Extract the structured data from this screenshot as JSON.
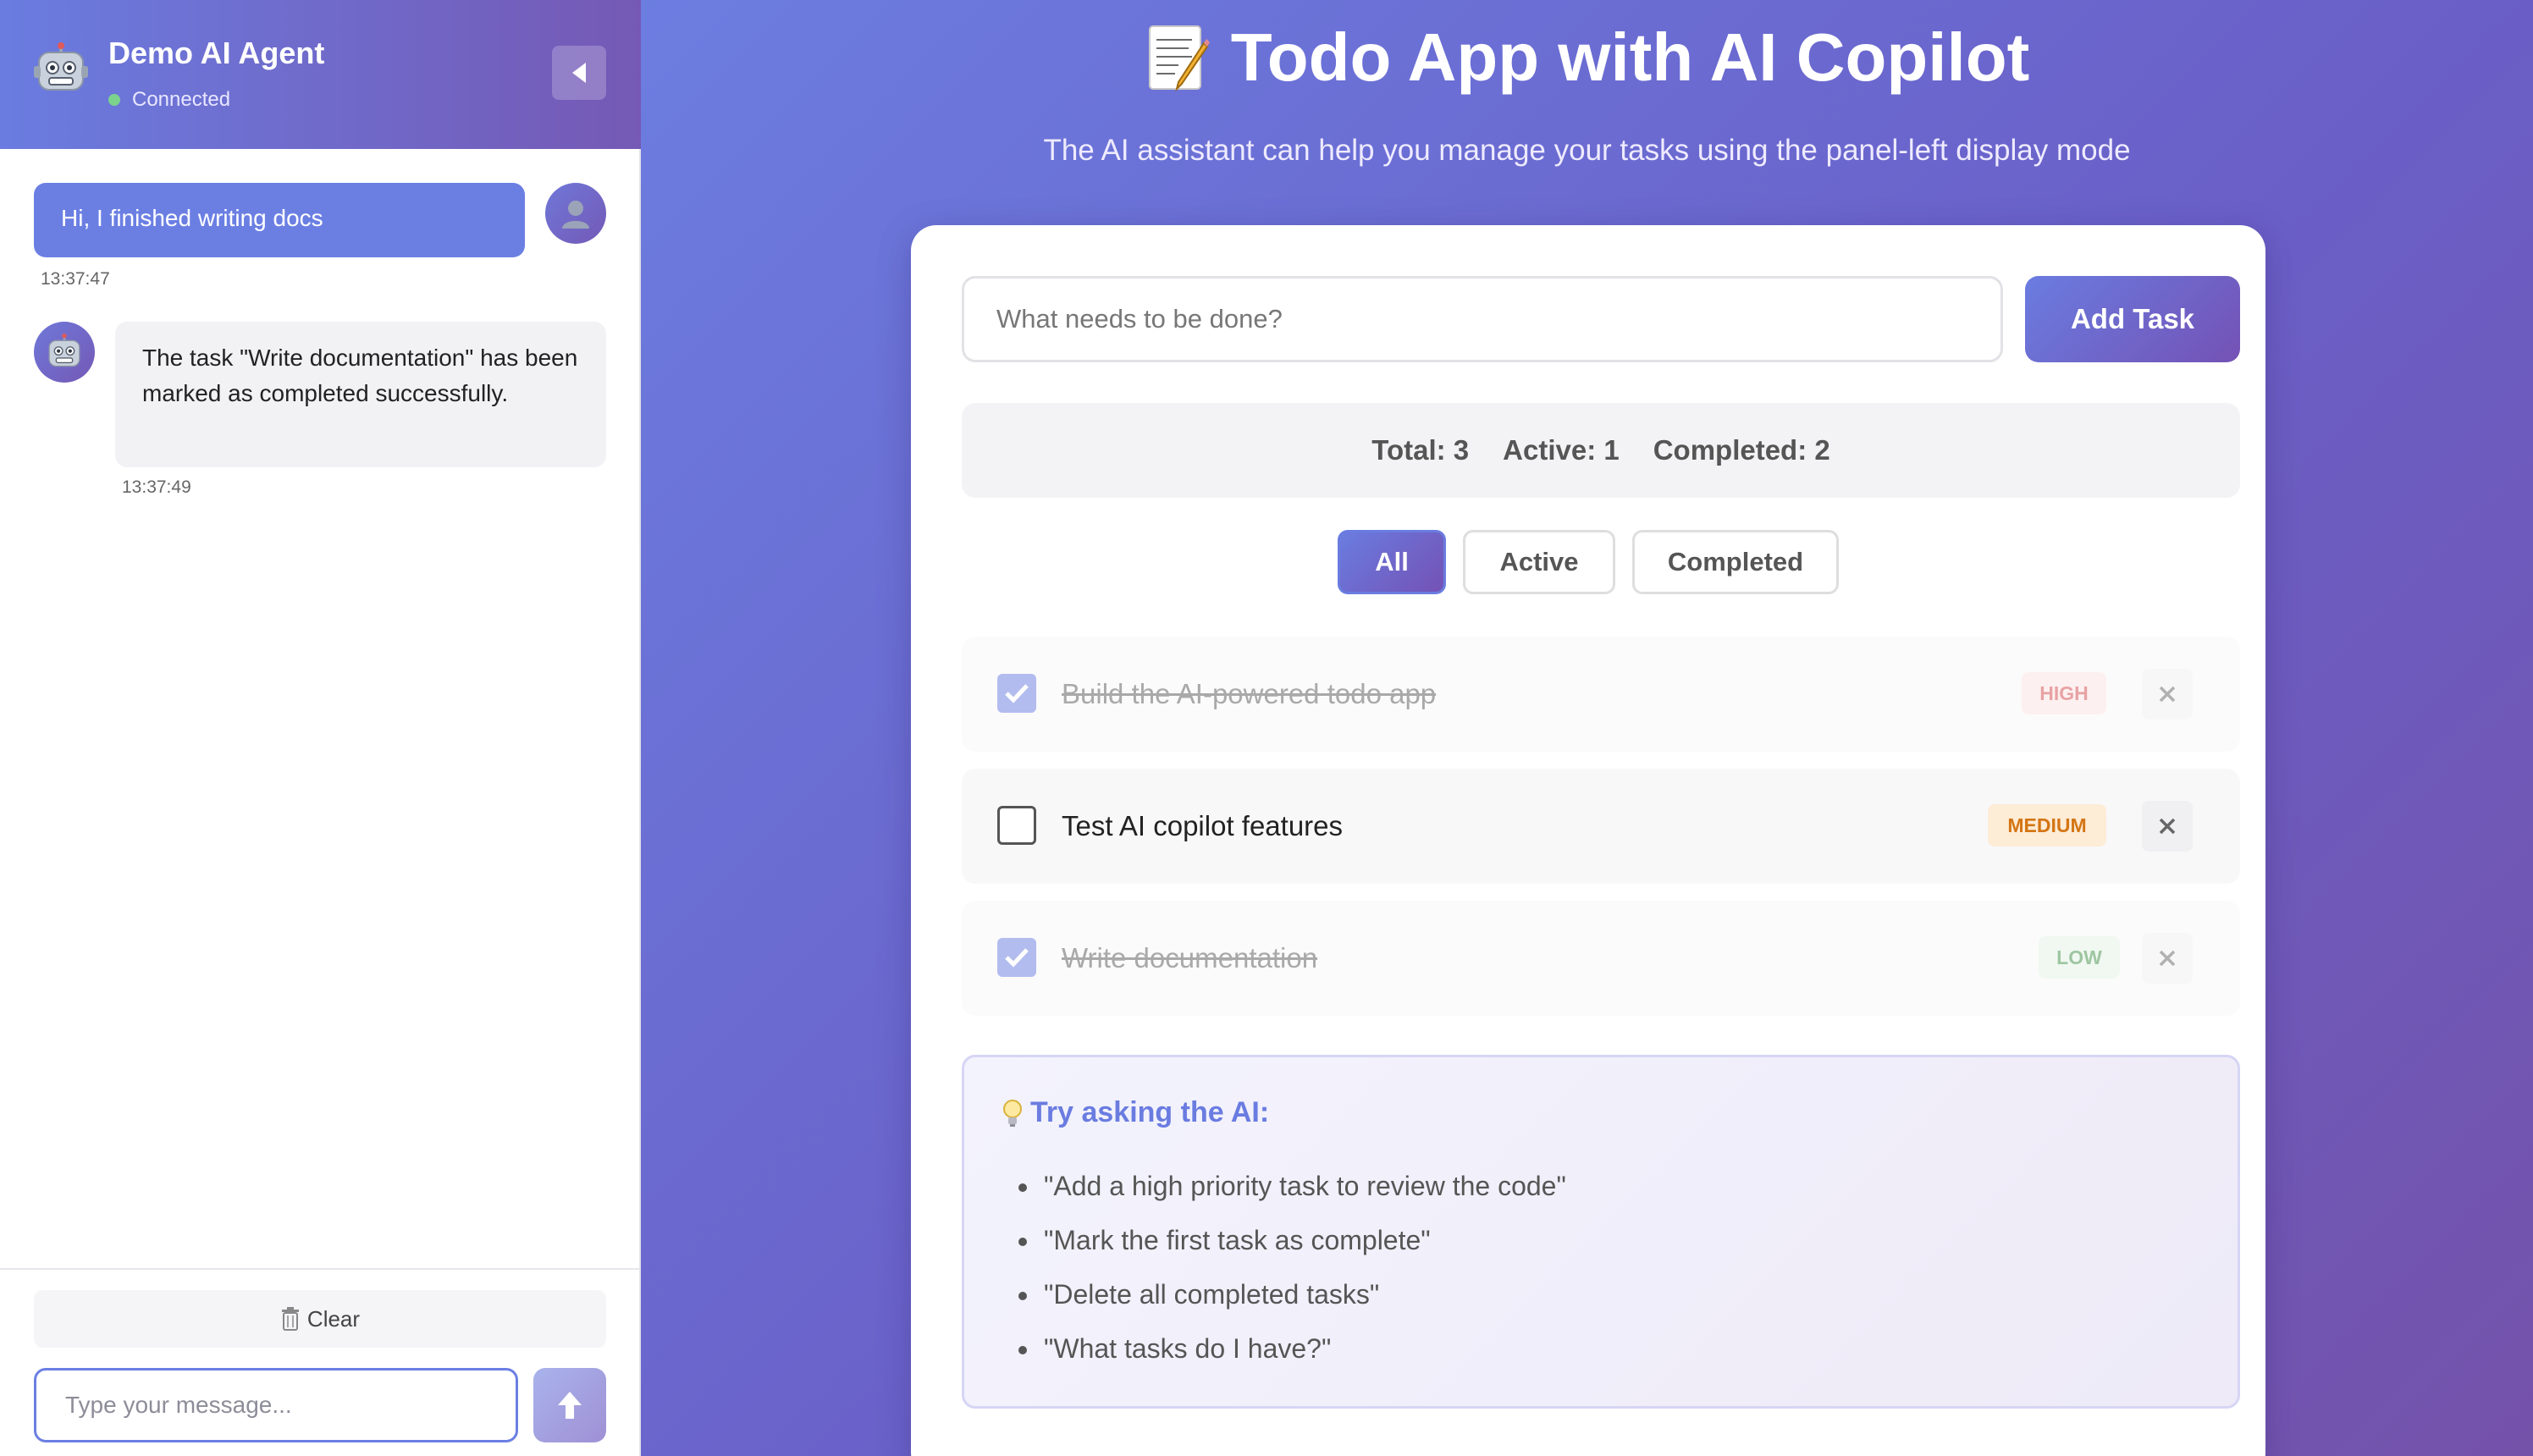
{
  "sidebar": {
    "agent_name": "Demo AI Agent",
    "status": "Connected",
    "messages": [
      {
        "role": "user",
        "text": "Hi, I finished writing docs",
        "time": "13:37:47"
      },
      {
        "role": "assistant",
        "text": "The task \"Write documentation\" has been marked as completed successfully.",
        "time": "13:37:49"
      }
    ],
    "clear_label": "Clear",
    "input_placeholder": "Type your message..."
  },
  "main": {
    "title": "Todo App with AI Copilot",
    "subtitle": "The AI assistant can help you manage your tasks using the panel-left display mode",
    "input_placeholder": "What needs to be done?",
    "add_button": "Add Task",
    "stats": {
      "total": "Total: 3",
      "active": "Active: 1",
      "completed": "Completed: 2"
    },
    "filters": [
      {
        "label": "All",
        "active": true
      },
      {
        "label": "Active",
        "active": false
      },
      {
        "label": "Completed",
        "active": false
      }
    ],
    "tasks": [
      {
        "text": "Build the AI-powered todo app",
        "priority": "HIGH",
        "completed": true
      },
      {
        "text": "Test AI copilot features",
        "priority": "MEDIUM",
        "completed": false
      },
      {
        "text": "Write documentation",
        "priority": "LOW",
        "completed": true
      }
    ],
    "tips": {
      "title": "Try asking the AI:",
      "items": [
        "\"Add a high priority task to review the code\"",
        "\"Mark the first task as complete\"",
        "\"Delete all completed tasks\"",
        "\"What tasks do I have?\""
      ]
    }
  },
  "icons": {
    "agent_avatar": "robot-icon",
    "user_avatar": "user-icon",
    "collapse": "caret-left-icon",
    "clear": "trash-icon",
    "send": "arrow-up-icon",
    "title": "memo-icon",
    "tips": "lightbulb-icon",
    "delete": "close-icon",
    "check": "checkmark-icon"
  },
  "colors": {
    "accent": "#6a7ce0",
    "accent_dark": "#7452b5",
    "high": "#d0484b",
    "medium": "#d47514",
    "low": "#3f8f45",
    "status_dot": "#7bd38d"
  }
}
